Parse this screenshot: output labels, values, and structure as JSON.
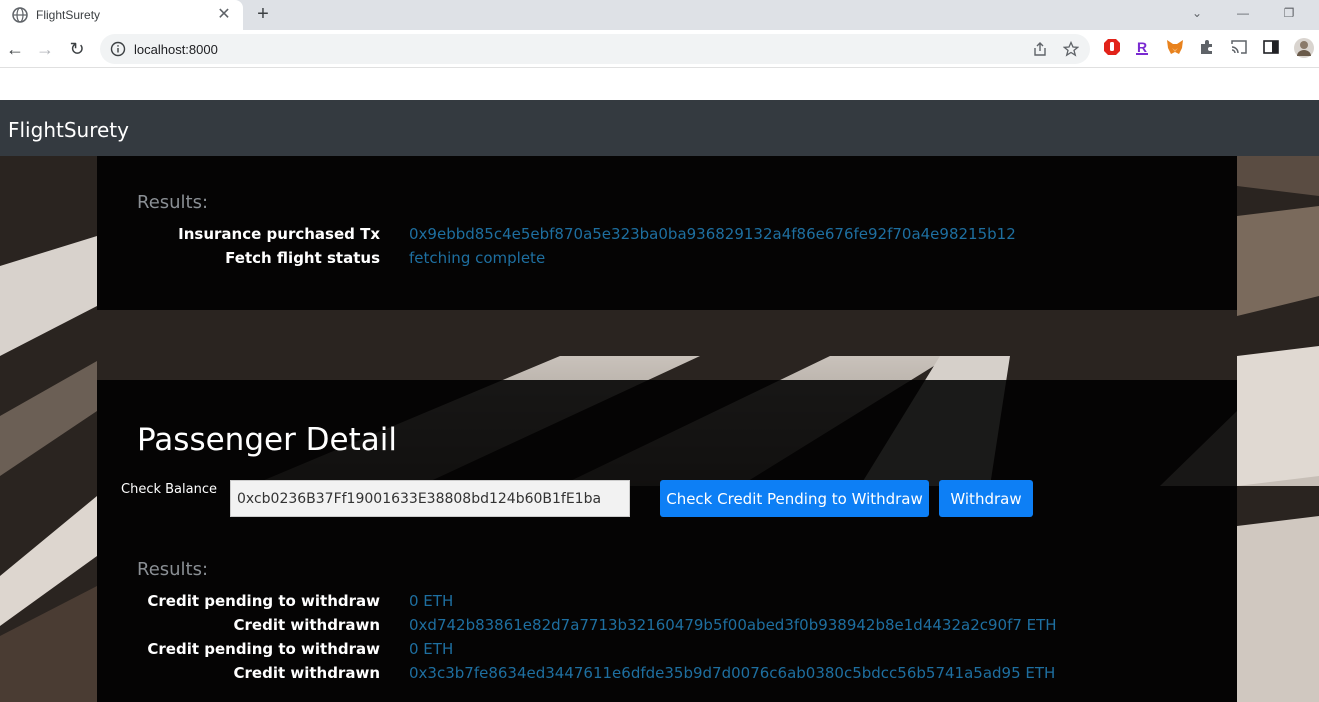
{
  "browser": {
    "tab_title": "FlightSurety",
    "url": "localhost:8000"
  },
  "navbar": {
    "brand": "FlightSurety"
  },
  "results_card": {
    "title": "Results:",
    "rows": [
      {
        "label": "Insurance purchased Tx",
        "value": "0x9ebbd85c4e5ebf870a5e323ba0ba936829132a4f86e676fe92f70a4e98215b12"
      },
      {
        "label": "Fetch flight status",
        "value": "fetching complete"
      }
    ]
  },
  "passenger_card": {
    "title": "Passenger Detail",
    "check_balance_label": "Check Balance",
    "address_value": "0xcb0236B37Ff19001633E38808bd124b60B1fE1ba",
    "check_credit_button": "Check Credit Pending to Withdraw",
    "withdraw_button": "Withdraw",
    "results_title": "Results:",
    "rows": [
      {
        "label": "Credit pending to withdraw",
        "value": "0 ETH"
      },
      {
        "label": "Credit withdrawn",
        "value": "0xd742b83861e82d7a7713b32160479b5f00abed3f0b938942b8e1d4432a2c90f7 ETH"
      },
      {
        "label": "Credit pending to withdraw",
        "value": "0 ETH"
      },
      {
        "label": "Credit withdrawn",
        "value": "0x3c3b7fe8634ed3447611e6dfde35b9d7d0076c6ab0380c5bdcc56b5741a5ad95 ETH"
      }
    ]
  },
  "colors": {
    "navbar": "#343a40",
    "button": "#0d7ff5",
    "link_value": "#1e6fa0"
  }
}
